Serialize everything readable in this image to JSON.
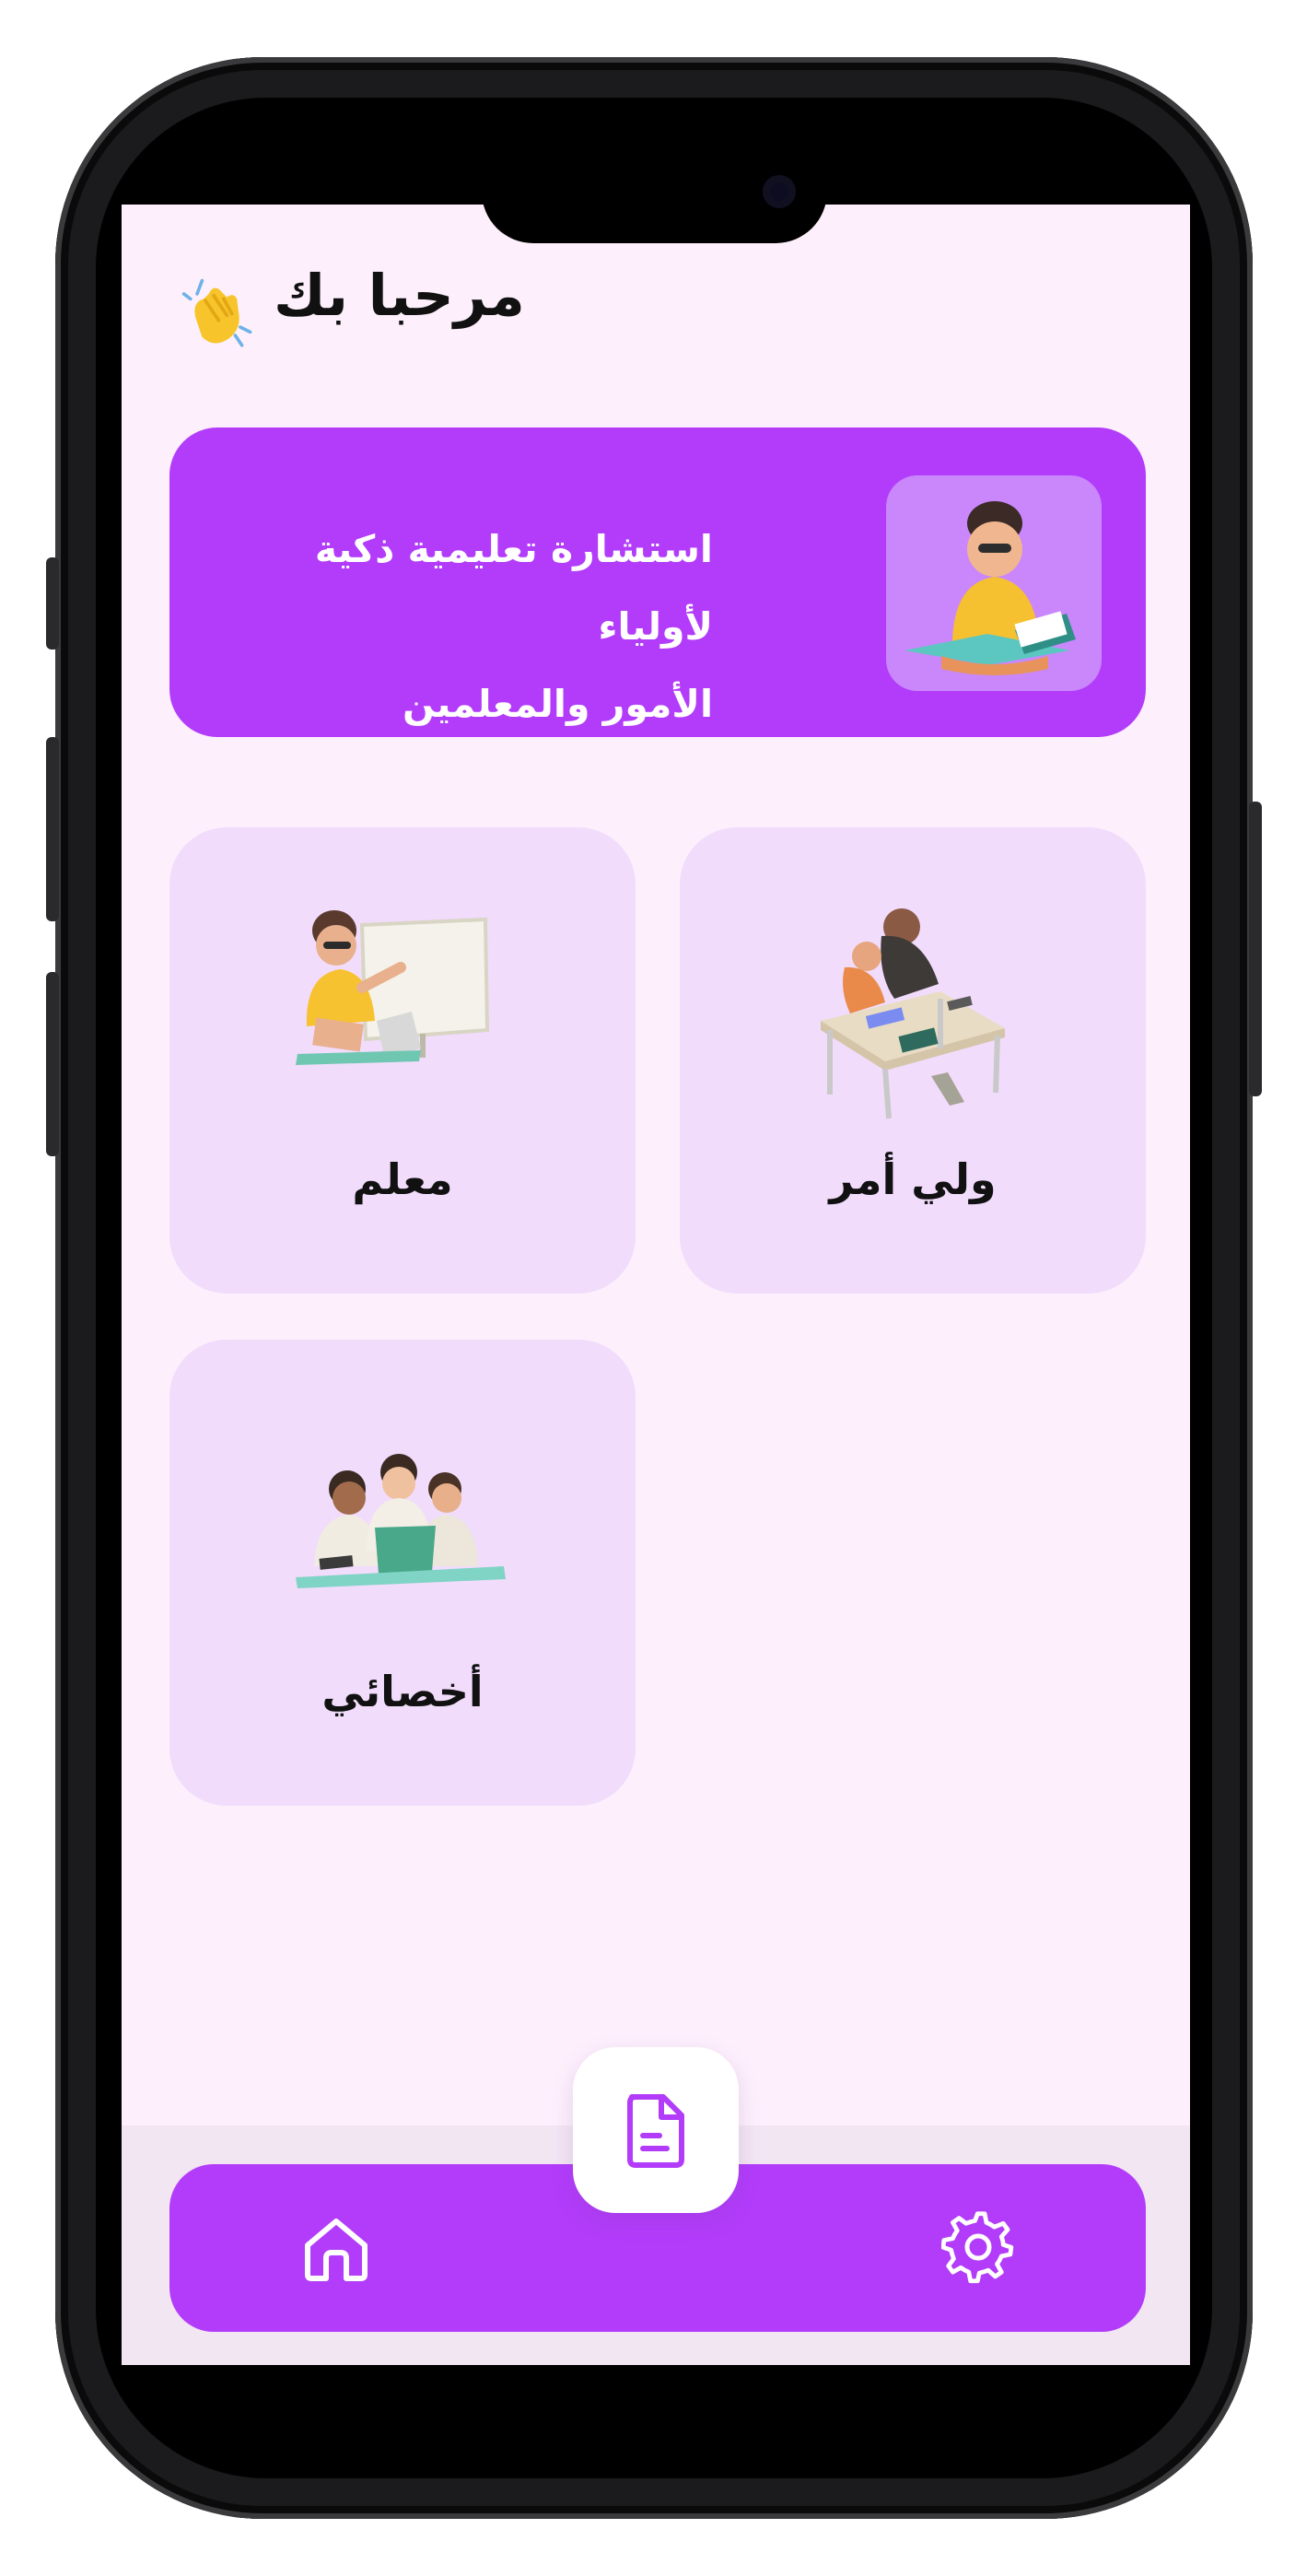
{
  "header": {
    "greeting": "مرحبا بك",
    "greeting_icon": "waving-hand-icon"
  },
  "banner": {
    "line1": "استشارة تعليمية ذكية لأولياء",
    "line2": "الأمور والمعلمين",
    "illustration": "student-reading-illustration"
  },
  "roles": [
    {
      "label": "ولي أمر",
      "illustration": "parent-child-studying-illustration"
    },
    {
      "label": "معلم",
      "illustration": "teacher-whiteboard-illustration"
    },
    {
      "label": "أخصائي",
      "illustration": "specialist-group-illustration"
    }
  ],
  "bottom_nav": {
    "home_icon": "home-icon",
    "center_icon": "document-icon",
    "settings_icon": "gear-icon"
  },
  "colors": {
    "accent": "#b23cfa",
    "background": "#fdf0fc",
    "card": "#f1dcfc",
    "banner_thumb": "#c987fb"
  }
}
